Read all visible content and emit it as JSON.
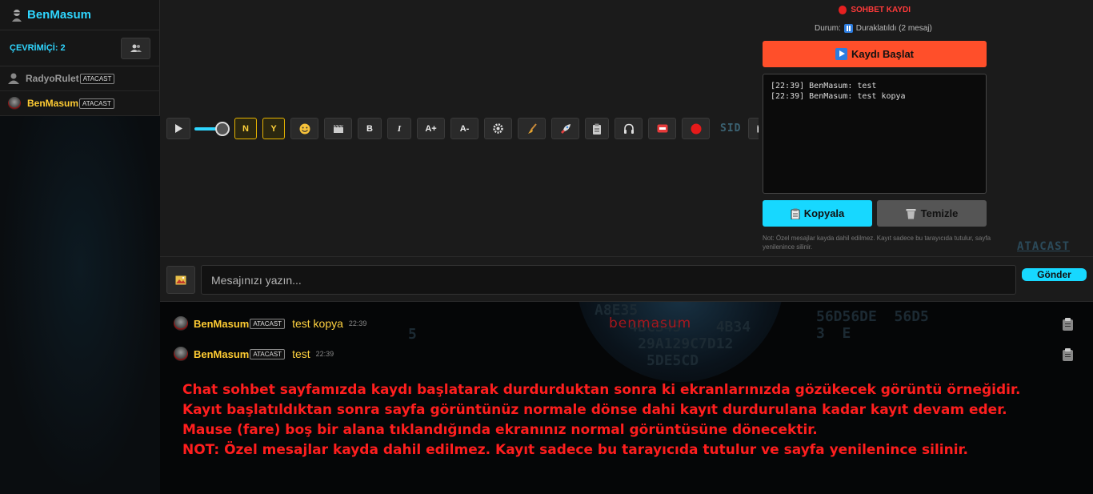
{
  "sidebar": {
    "title": "BenMasum",
    "online_label": "ÇEVRİMİÇİ: 2",
    "users": [
      {
        "name": "RadyoRulet",
        "badge": "ATACAST",
        "color": "#9a9a9a"
      },
      {
        "name": "BenMasum",
        "badge": "ATACAST",
        "color": "#ffcc33"
      }
    ]
  },
  "toolbar": {
    "n_label": "N",
    "y_label": "Y",
    "bold_label": "B",
    "italic_label": "I",
    "font_up_label": "A+",
    "font_down_label": "A-",
    "sid_label": "SID",
    "volume_level": 0.85
  },
  "recording": {
    "title": "SOHBET KAYDI",
    "status_prefix": "Durum:",
    "status_text": "Duraklatıldı (2 mesaj)",
    "start_label": "Kaydı Başlat",
    "log_lines": [
      "[22:39] BenMasum: test",
      "[22:39] BenMasum: test kopya"
    ],
    "copy_label": "Kopyala",
    "clear_label": "Temizle",
    "note": "Not: Özel mesajlar kayda dahil edilmez. Kayıt sadece bu tarayıcıda tutulur, sayfa yenilenince silinir.",
    "logo_text": "ATACAST"
  },
  "input": {
    "placeholder": "Mesajınızı yazın...",
    "send_label": "Gönder"
  },
  "chat": {
    "watermark": "benmasum",
    "messages": [
      {
        "user": "BenMasum",
        "badge": "ATACAST",
        "text": "test kopya",
        "time": "22:39"
      },
      {
        "user": "BenMasum",
        "badge": "ATACAST",
        "text": "test",
        "time": "22:39"
      }
    ],
    "notice_lines": [
      "Chat sohbet sayfamızda kaydı başlatarak durdurduktan sonra ki ekranlarınızda gözükecek görüntü örneğidir.",
      "Kayıt başlatıldıktan sonra sayfa görüntünüz normale dönse dahi kayıt durdurulana kadar kayıt devam eder.",
      "Mause (fare) boş bir alana tıklandığında ekranınız normal görüntüsüne dönecektir.",
      "NOT: Özel mesajlar kayda dahil edilmez. Kayıt sadece bu tarayıcıda tutulur ve sayfa yenilenince silinir."
    ]
  },
  "colors": {
    "accent": "#17d8ff",
    "record_red": "#ff4f2a",
    "username_gold": "#ffcc33",
    "notice_red": "#ff1e1e"
  }
}
